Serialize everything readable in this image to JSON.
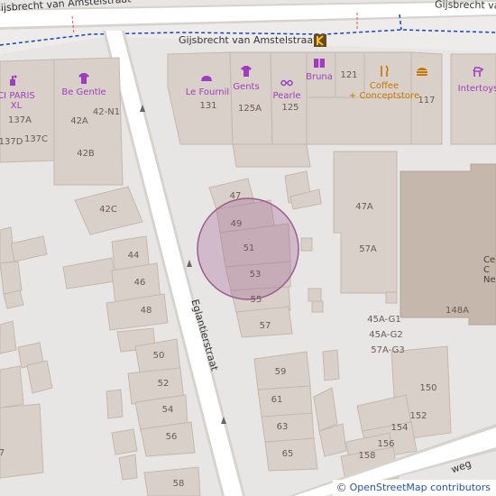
{
  "streets": [
    {
      "id": "gijsbrecht-top-left",
      "text": "Gijsbrecht van Amstelstraat"
    },
    {
      "id": "gijsbrecht-top-right",
      "text": "Gijsbrecht va"
    },
    {
      "id": "gijsbrecht-mid",
      "text": "Gijsbrecht van Amstelstraat"
    },
    {
      "id": "eglantierstraat",
      "text": "Eglantierstraat"
    },
    {
      "id": "weg",
      "text": "weg"
    }
  ],
  "pois": [
    {
      "id": "ci-paris",
      "text": "CI PARIS\nXL",
      "icon": "perfume-icon"
    },
    {
      "id": "be-gentle",
      "text": "Be Gentle",
      "icon": "shirt-icon"
    },
    {
      "id": "le-fournil",
      "text": "Le Fournil",
      "icon": "bread-icon"
    },
    {
      "id": "gents",
      "text": "Gents",
      "icon": "shirt-icon"
    },
    {
      "id": "pearle",
      "text": "Pearle",
      "icon": "glasses-icon"
    },
    {
      "id": "bruna",
      "text": "Bruna",
      "icon": "book-icon"
    },
    {
      "id": "coffee",
      "text": "Coffee\n+ Conceptstore",
      "icon": "cutlery-icon"
    },
    {
      "id": "burger",
      "text": "",
      "icon": "burger-icon"
    },
    {
      "id": "intertoys",
      "text": "Intertoys",
      "icon": "toy-horse-icon"
    },
    {
      "id": "cinema",
      "text": "Ce\nC\nNe",
      "icon": ""
    }
  ],
  "house_numbers": [
    "137A",
    "137D",
    "137C",
    "42A",
    "42-N1",
    "42B",
    "131",
    "125A",
    "125",
    "121",
    "117",
    "42C",
    "47",
    "49",
    "51",
    "53",
    "55",
    "57",
    "47A",
    "57A",
    "44",
    "46",
    "48",
    "50",
    "52",
    "54",
    "56",
    "58",
    "59",
    "61",
    "63",
    "65",
    "148A",
    "45A-G1",
    "45A-G2",
    "57A-G3",
    "150",
    "152",
    "154",
    "156",
    "158",
    "7"
  ],
  "highlight": {
    "color": "#9b5b8e",
    "fill_opacity": 0.3
  },
  "colors": {
    "background": "#e8e6e4",
    "building": "#d9d0c9",
    "building_stroke": "#c4b8ae",
    "road": "#ffffff",
    "road_casing": "#d0ccc8",
    "boundary": "#1a3fc0",
    "poi_purple": "#a03dbf",
    "poi_orange": "#c77400",
    "landmark": "#c5b7ab"
  },
  "attribution": {
    "symbol": "©",
    "text": "OpenStreetMap contributors"
  }
}
